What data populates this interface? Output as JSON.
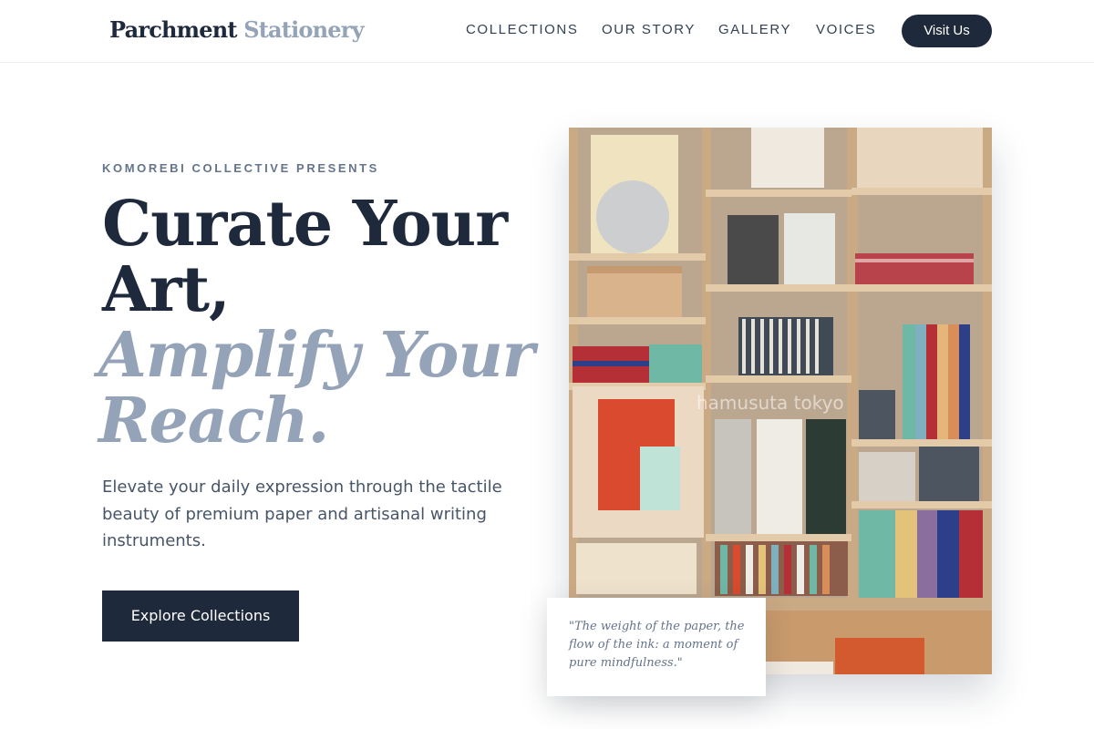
{
  "brand": {
    "part1": "Parchment",
    "part2": "Stationery"
  },
  "nav": {
    "items": [
      {
        "label": "COLLECTIONS"
      },
      {
        "label": "OUR STORY"
      },
      {
        "label": "GALLERY"
      },
      {
        "label": "VOICES"
      }
    ],
    "cta_label": "Visit Us"
  },
  "hero": {
    "eyebrow": "KOMOREBI COLLECTIVE PRESENTS",
    "headline_line1": "Curate Your",
    "headline_line2": "Art,",
    "headline_accent_line1": "Amplify Your",
    "headline_accent_line2": "Reach.",
    "lead": "Elevate your daily expression through the tactile beauty of premium paper and artisanal writing instruments.",
    "cta_label": "Explore Collections"
  },
  "image": {
    "watermark": "hamusuta tokyo"
  },
  "quote": {
    "text": "\"The weight of the paper, the flow of the ink: a moment of pure mindfulness.\""
  },
  "colors": {
    "primary": "#1e293b",
    "muted": "#94a3b8",
    "text": "#475569"
  }
}
